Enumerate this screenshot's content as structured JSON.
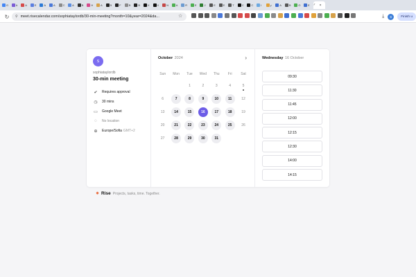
{
  "browser": {
    "tabs": [
      {
        "label": "G",
        "color": "#4285f4"
      },
      {
        "label": "A",
        "color": "#7b5cd6"
      },
      {
        "label": "A",
        "color": "#d64a4a"
      },
      {
        "label": "E",
        "color": "#5b7fe0"
      },
      {
        "label": "A",
        "color": "#2b7ad6"
      },
      {
        "label": "A",
        "color": "#4a78d8"
      },
      {
        "label": "C",
        "color": "#8a8a8a"
      },
      {
        "label": "A",
        "color": "#5b8de0"
      },
      {
        "label": "B",
        "color": "#333333"
      },
      {
        "label": "H",
        "color": "#d64a8c"
      },
      {
        "label": "A",
        "color": "#d6a14a"
      },
      {
        "label": "B",
        "color": "#222222"
      },
      {
        "label": "F",
        "color": "#222222"
      },
      {
        "label": "B",
        "color": "#8a8a8a"
      },
      {
        "label": "B",
        "color": "#222222"
      },
      {
        "label": "X",
        "color": "#111111"
      },
      {
        "label": "X",
        "color": "#111111"
      },
      {
        "label": "N",
        "color": "#c44747"
      },
      {
        "label": "A",
        "color": "#4caf50"
      },
      {
        "label": "R",
        "color": "#6b9bd1"
      },
      {
        "label": "E",
        "color": "#4caf50"
      },
      {
        "label": "J",
        "color": "#2e7d32"
      },
      {
        "label": "E",
        "color": "#555555"
      },
      {
        "label": "E",
        "color": "#555555"
      },
      {
        "label": "T",
        "color": "#555555"
      },
      {
        "label": "C",
        "color": "#111111"
      },
      {
        "label": "C",
        "color": "#111111"
      },
      {
        "label": "I",
        "color": "#6ba8e0"
      },
      {
        "label": "y",
        "color": "#e0a13a"
      },
      {
        "label": "A",
        "color": "#3f6fd0"
      },
      {
        "label": "B",
        "color": "#555555"
      },
      {
        "label": "G",
        "color": "#4caf50"
      },
      {
        "label": "E",
        "color": "#3f6fd0"
      }
    ],
    "active_tab": {
      "label": "?",
      "close": "×"
    },
    "address": "meet.risecalendar.com/sophiataylordb/30-min-meeting?month=10&year=2024&da...",
    "extension_colors": [
      "#555555",
      "#555555",
      "#555555",
      "#888888",
      "#4a78d8",
      "#777777",
      "#555555",
      "#d64a4a",
      "#d64a4a",
      "#444444",
      "#6b9bd1",
      "#4caf50",
      "#8a8a8a",
      "#d6a14a",
      "#3f6fd0",
      "#4caf50",
      "#4a78d8",
      "#d64a4a",
      "#e0a13a",
      "#888888",
      "#4caf50",
      "#d6a14a",
      "#555555",
      "#222222",
      "#777777"
    ],
    "profile_initial": "S",
    "finish_update_label": "Finish u"
  },
  "host": {
    "avatar_initial": "S",
    "name": "sophiataylordb"
  },
  "event": {
    "title": "30-min meeting",
    "details": [
      {
        "icon": "check-circle-icon",
        "glyph": "✔",
        "text": "Requires approval",
        "muted": false
      },
      {
        "icon": "clock-icon",
        "glyph": "◷",
        "text": "30 mins",
        "muted": false
      },
      {
        "icon": "video-icon",
        "glyph": "▭",
        "text": "Google Meet",
        "muted": false
      },
      {
        "icon": "location-pin-icon",
        "glyph": "◌",
        "text": "No location",
        "muted": true
      },
      {
        "icon": "globe-icon",
        "glyph": "⊕",
        "text": "Europe/Sofia",
        "muted": false,
        "tz_offset": "GMT+2"
      }
    ]
  },
  "calendar": {
    "month": "October",
    "year": "2024",
    "next_icon": "›",
    "weekdays": [
      "Sun",
      "Mon",
      "Tue",
      "Wed",
      "Thu",
      "Fri",
      "Sat"
    ],
    "weeks": [
      [
        {
          "d": ""
        },
        {
          "d": ""
        },
        {
          "d": "1"
        },
        {
          "d": "2"
        },
        {
          "d": "3"
        },
        {
          "d": "4"
        },
        {
          "d": "5",
          "today": true
        }
      ],
      [
        {
          "d": "6"
        },
        {
          "d": "7",
          "avail": true
        },
        {
          "d": "8",
          "avail": true
        },
        {
          "d": "9",
          "avail": true
        },
        {
          "d": "10",
          "avail": true
        },
        {
          "d": "11",
          "avail": true
        },
        {
          "d": "12"
        }
      ],
      [
        {
          "d": "13"
        },
        {
          "d": "14",
          "avail": true
        },
        {
          "d": "15",
          "avail": true
        },
        {
          "d": "16",
          "selected": true
        },
        {
          "d": "17",
          "avail": true
        },
        {
          "d": "18",
          "avail": true
        },
        {
          "d": "19"
        }
      ],
      [
        {
          "d": "20"
        },
        {
          "d": "21",
          "avail": true
        },
        {
          "d": "22",
          "avail": true
        },
        {
          "d": "23",
          "avail": true
        },
        {
          "d": "24",
          "avail": true
        },
        {
          "d": "25",
          "avail": true
        },
        {
          "d": "26"
        }
      ],
      [
        {
          "d": "27"
        },
        {
          "d": "28",
          "avail": true
        },
        {
          "d": "29",
          "avail": true
        },
        {
          "d": "30",
          "avail": true
        },
        {
          "d": "31",
          "avail": true
        },
        {
          "d": ""
        },
        {
          "d": ""
        }
      ]
    ]
  },
  "slots": {
    "day": "Wednesday",
    "date": "16 October",
    "times": [
      "09:30",
      "11:30",
      "11:45",
      "12:00",
      "12:15",
      "12:30",
      "14:00",
      "14:15"
    ]
  },
  "footer": {
    "brand": "Rise",
    "tagline": "Projects, tasks, time. Together."
  }
}
